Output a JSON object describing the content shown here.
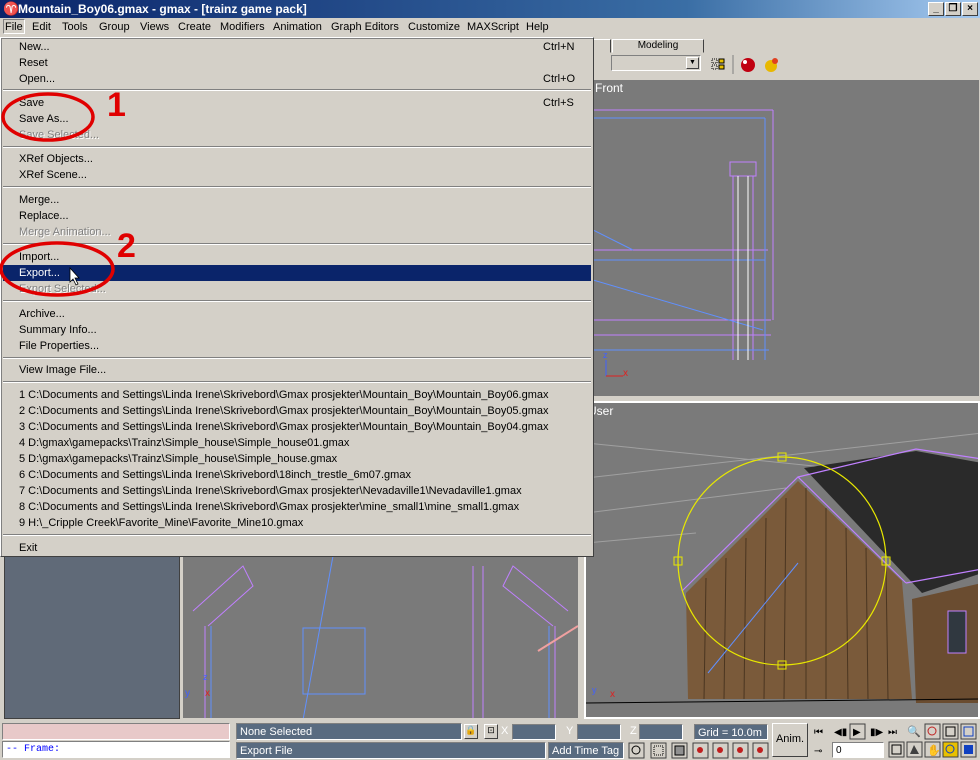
{
  "window": {
    "title": "Mountain_Boy06.gmax - gmax - [trainz game pack]",
    "buttons": [
      "_",
      "❐",
      "×"
    ]
  },
  "menubar": [
    "File",
    "Edit",
    "Tools",
    "Group",
    "Views",
    "Create",
    "Modifiers",
    "Animation",
    "Graph Editors",
    "Customize",
    "MAXScript",
    "Help"
  ],
  "toolbar": {
    "tab_label": "Modeling"
  },
  "file_menu": {
    "items": [
      {
        "label": "New...",
        "shortcut": "Ctrl+N"
      },
      {
        "label": "Reset",
        "shortcut": ""
      },
      {
        "label": "Open...",
        "shortcut": "Ctrl+O"
      },
      {
        "label": "Save",
        "shortcut": "Ctrl+S"
      },
      {
        "label": "Save As...",
        "shortcut": ""
      },
      {
        "label": "Save Selected...",
        "shortcut": ""
      },
      {
        "label": "XRef Objects...",
        "shortcut": ""
      },
      {
        "label": "XRef Scene...",
        "shortcut": ""
      },
      {
        "label": "Merge...",
        "shortcut": ""
      },
      {
        "label": "Replace...",
        "shortcut": ""
      },
      {
        "label": "Merge Animation...",
        "shortcut": ""
      },
      {
        "label": "Import...",
        "shortcut": ""
      },
      {
        "label": "Export...",
        "shortcut": ""
      },
      {
        "label": "Export Selected...",
        "shortcut": ""
      },
      {
        "label": "Archive...",
        "shortcut": ""
      },
      {
        "label": "Summary Info...",
        "shortcut": ""
      },
      {
        "label": "File Properties...",
        "shortcut": ""
      },
      {
        "label": "View Image File...",
        "shortcut": ""
      },
      {
        "label": "1 C:\\Documents and Settings\\Linda Irene\\Skrivebord\\Gmax prosjekter\\Mountain_Boy\\Mountain_Boy06.gmax",
        "shortcut": ""
      },
      {
        "label": "2 C:\\Documents and Settings\\Linda Irene\\Skrivebord\\Gmax prosjekter\\Mountain_Boy\\Mountain_Boy05.gmax",
        "shortcut": ""
      },
      {
        "label": "3 C:\\Documents and Settings\\Linda Irene\\Skrivebord\\Gmax prosjekter\\Mountain_Boy\\Mountain_Boy04.gmax",
        "shortcut": ""
      },
      {
        "label": "4 D:\\gmax\\gamepacks\\Trainz\\Simple_house\\Simple_house01.gmax",
        "shortcut": ""
      },
      {
        "label": "5 D:\\gmax\\gamepacks\\Trainz\\Simple_house\\Simple_house.gmax",
        "shortcut": ""
      },
      {
        "label": "6 C:\\Documents and Settings\\Linda Irene\\Skrivebord\\18inch_trestle_6m07.gmax",
        "shortcut": ""
      },
      {
        "label": "7 C:\\Documents and Settings\\Linda Irene\\Skrivebord\\Gmax prosjekter\\Nevadaville1\\Nevadaville1.gmax",
        "shortcut": ""
      },
      {
        "label": "8 C:\\Documents and Settings\\Linda Irene\\Skrivebord\\Gmax prosjekter\\mine_small1\\mine_small1.gmax",
        "shortcut": ""
      },
      {
        "label": "9 H:\\_Cripple Creek\\Favorite_Mine\\Favorite_Mine10.gmax",
        "shortcut": ""
      },
      {
        "label": "Exit",
        "shortcut": ""
      }
    ]
  },
  "annotations": {
    "one": "1",
    "two": "2"
  },
  "viewports": {
    "front_label": "Front",
    "user_label": "User",
    "axis_z": "z",
    "axis_x": "x",
    "axis_y": "y"
  },
  "statusbar": {
    "selection": "None Selected",
    "prompt": "Export File",
    "x_label": "X",
    "y_label": "Y",
    "z_label": "Z",
    "grid": "Grid = 10.0m",
    "add_time_tag": "Add Time Tag",
    "anim": "Anim.",
    "frame_field": "0",
    "maxscript_output": "-- Frame:"
  },
  "colors": {
    "highlight": "#0a246a",
    "annotation_red": "#e00000",
    "selection_yellow": "#e8e800",
    "wire_purple": "#c080ff"
  }
}
